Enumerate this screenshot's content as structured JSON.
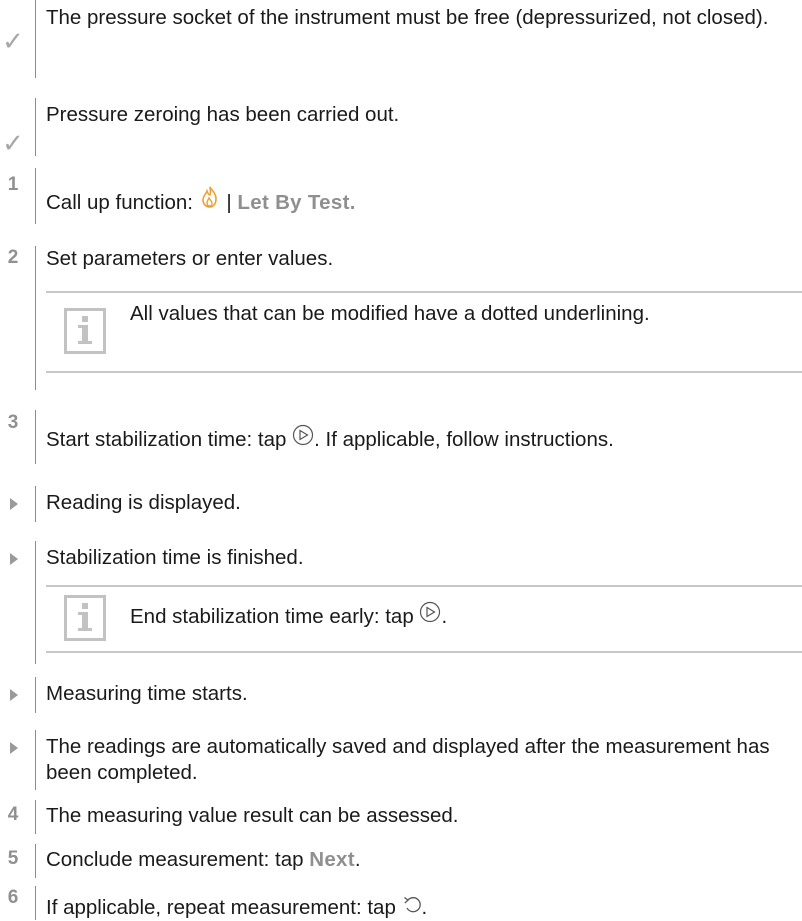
{
  "steps": [
    {
      "marker": "✓",
      "text": "The pressure socket of the instrument must be free (depressurized, not closed)."
    },
    {
      "marker": "✓",
      "text": "Pressure zeroing has been carried out."
    },
    {
      "marker": "1",
      "text_before": "Call up function: ",
      "text_sep": " | ",
      "keyword": "Let By Test."
    },
    {
      "marker": "2",
      "text": "Set parameters or enter values."
    },
    {
      "info": "All values that can be modified have a dotted underlining."
    },
    {
      "marker": "3",
      "text_before": "Start stabilization time: tap ",
      "text_after": ". If applicable, follow instructions."
    },
    {
      "marker": "▸",
      "text": "Reading is displayed."
    },
    {
      "marker": "▸",
      "text": "Stabilization time is finished."
    },
    {
      "info_before": "End stabilization time early: tap ",
      "info_after": "."
    },
    {
      "marker": "▸",
      "text": "Measuring time starts."
    },
    {
      "marker": "▸",
      "text": "The readings are automatically saved and displayed after the measurement has been completed."
    },
    {
      "marker": "4",
      "text": "The measuring value result can be assessed."
    },
    {
      "marker": "5",
      "text_before": "Conclude measurement: tap ",
      "keyword": "Next",
      "text_after": "."
    },
    {
      "marker": "6",
      "text_before": "If applicable, repeat measurement: tap ",
      "text_after": "."
    }
  ],
  "icons": {
    "flame": "flame-icon",
    "play": "play-circle-icon",
    "repeat": "repeat-icon",
    "info": "info-icon"
  },
  "colors": {
    "marker": "#9a9a9a",
    "keyword": "#8f8f8f",
    "flame": "#f0a030",
    "rule": "#8c8c8c"
  }
}
